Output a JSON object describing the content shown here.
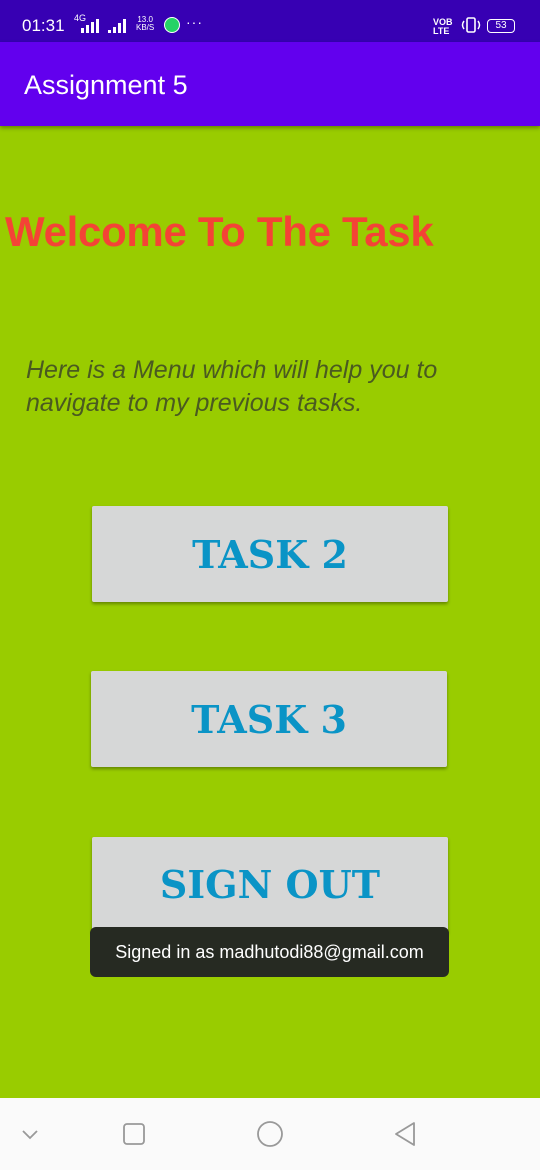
{
  "status_bar": {
    "time": "01:31",
    "network_type": "4G",
    "speed_value": "13.0",
    "speed_unit": "KB/S",
    "more": "···",
    "volte_top": "VOB",
    "volte_bottom": "LTE",
    "battery": "53"
  },
  "app_bar": {
    "title": "Assignment 5"
  },
  "main": {
    "welcome": "Welcome To The Task",
    "subtitle": " Here is a Menu which will help you to navigate to my previous tasks.",
    "buttons": [
      "TASK 2",
      "TASK 3",
      "SIGN OUT"
    ]
  },
  "toast": {
    "text": "Signed in as madhutodi88@gmail.com"
  },
  "colors": {
    "status_bar": "#3700b3",
    "app_bar": "#6200ee",
    "background": "#99cc00",
    "welcome_text": "#f44336",
    "button_bg": "#d6d7d7",
    "button_text": "#0a94c6"
  },
  "nav_bar": {
    "icons": [
      "chevron-down-icon",
      "recents-square-icon",
      "home-circle-icon",
      "back-triangle-icon"
    ]
  }
}
